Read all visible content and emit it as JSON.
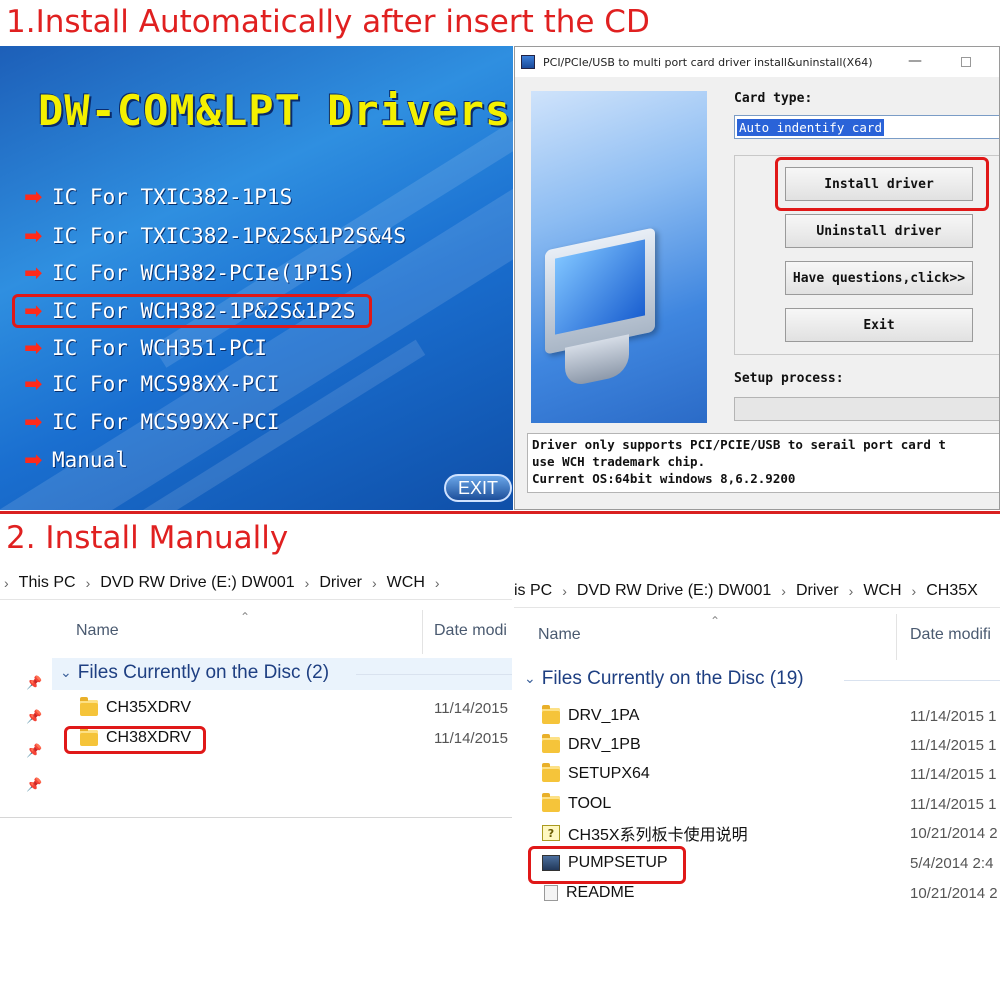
{
  "headings": {
    "step1": "1.Install Automatically after insert the CD",
    "step2": "2. Install Manually"
  },
  "autorun": {
    "title": "DW-COM&LPT Drivers",
    "items": [
      {
        "label": "IC For TXIC382-1P1S"
      },
      {
        "label": "IC For TXIC382-1P&2S&1P2S&4S"
      },
      {
        "label": "IC For WCH382-PCIe(1P1S)"
      },
      {
        "label": "IC For WCH382-1P&2S&1P2S"
      },
      {
        "label": "IC For WCH351-PCI"
      },
      {
        "label": "IC For MCS98XX-PCI"
      },
      {
        "label": "IC For MCS99XX-PCI"
      },
      {
        "label": "Manual"
      }
    ],
    "exit_label": "EXIT",
    "arrow_icon": "right-arrow-icon",
    "title_color": "#f4f000",
    "arrow_color": "#ff2a1a"
  },
  "dialog": {
    "title": "PCI/PCIe/USB to multi port card driver install&uninstall(X64)",
    "card_type_label": "Card type:",
    "card_type_value": "Auto indentify card",
    "buttons": {
      "install": "Install driver",
      "uninstall": "Uninstall driver",
      "questions": "Have questions,click>>",
      "exit": "Exit"
    },
    "setup_process_label": "Setup process:",
    "progress": 0,
    "info_lines": [
      "Driver only supports PCI/PCIE/USB to serail port card t",
      "use WCH trademark chip.",
      "Current OS:64bit windows 8,6.2.9200"
    ]
  },
  "explorer_left": {
    "breadcrumb": [
      "This PC",
      "DVD RW Drive (E:) DW001",
      "Driver",
      "WCH"
    ],
    "columns": {
      "name": "Name",
      "date": "Date modi"
    },
    "group": "Files Currently on the Disc (2)",
    "rows": [
      {
        "name": "CH35XDRV",
        "date": "11/14/2015",
        "icon": "folder-icon"
      },
      {
        "name": "CH38XDRV",
        "date": "11/14/2015",
        "icon": "folder-icon"
      }
    ]
  },
  "explorer_right": {
    "breadcrumb": [
      "is PC",
      "DVD RW Drive (E:) DW001",
      "Driver",
      "WCH",
      "CH35X"
    ],
    "columns": {
      "name": "Name",
      "date": "Date modifi"
    },
    "group": "Files Currently on the Disc (19)",
    "rows": [
      {
        "name": "DRV_1PA",
        "date": "11/14/2015 1",
        "icon": "folder-icon"
      },
      {
        "name": "DRV_1PB",
        "date": "11/14/2015 1",
        "icon": "folder-icon"
      },
      {
        "name": "SETUPX64",
        "date": "11/14/2015 1",
        "icon": "folder-icon"
      },
      {
        "name": "TOOL",
        "date": "11/14/2015 1",
        "icon": "folder-icon"
      },
      {
        "name": "CH35X系列板卡使用说明",
        "date": "10/21/2014 2",
        "icon": "help-file-icon"
      },
      {
        "name": "PUMPSETUP",
        "date": "5/4/2014 2:4",
        "icon": "setup-app-icon"
      },
      {
        "name": "README",
        "date": "10/21/2014 2",
        "icon": "text-file-icon"
      }
    ]
  },
  "colors": {
    "highlight": "#e01818",
    "heading": "#e02020"
  }
}
